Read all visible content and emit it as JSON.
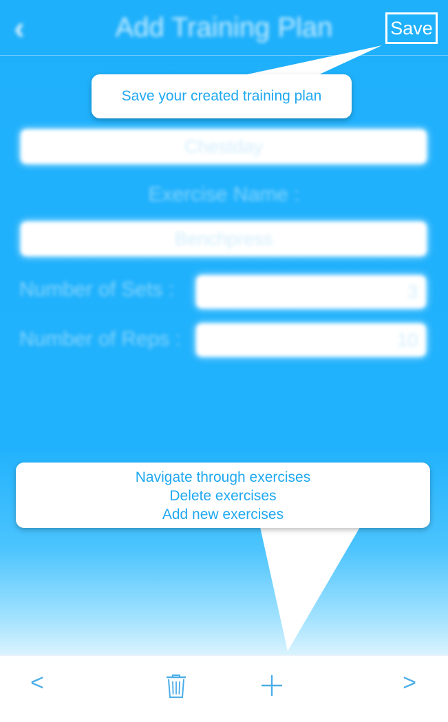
{
  "nav": {
    "back_glyph": "‹",
    "title": "Add Training Plan",
    "save_label": "Save"
  },
  "form": {
    "plan_name_value": "Chestday",
    "exercise_label": "Exercise Name :",
    "exercise_value": "Benchpress",
    "sets_label": "Number of Sets :",
    "sets_value": "3",
    "reps_label": "Number of Reps :",
    "reps_value": "10"
  },
  "tooltips": {
    "save_tip": "Save your created training plan",
    "toolbar_tip_lines": [
      "Navigate through exercises",
      "Delete exercises",
      "Add new exercises"
    ]
  },
  "toolbar": {
    "prev_glyph": "<",
    "next_glyph": ">",
    "delete_icon": "trash-icon",
    "add_icon": "plus-icon"
  },
  "colors": {
    "accent": "#21b2fd",
    "tooltip_text": "#1fa8f0",
    "toolbar_icon": "#4aaee8"
  }
}
